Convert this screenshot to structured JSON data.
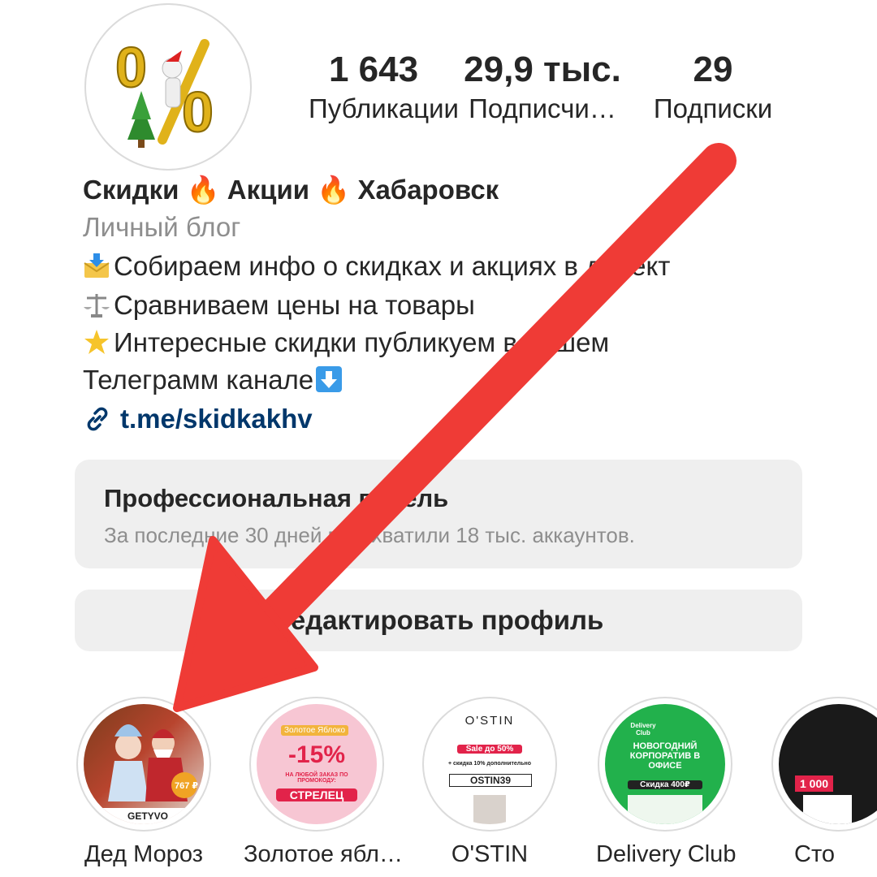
{
  "profile": {
    "avatar_text": "0%"
  },
  "stats": [
    {
      "value": "1 643",
      "label": "Публикации"
    },
    {
      "value": "29,9 тыс.",
      "label": "Подписчи…"
    },
    {
      "value": "29",
      "label": "Подписки"
    }
  ],
  "bio": {
    "title": "Скидки 🔥 Акции 🔥 Хабаровск",
    "category": "Личный блог",
    "line1": "Собираем инфо о скидках и акциях в директ",
    "line2": "Сравниваем цены на товары",
    "line3": "Интересные скидки публикуем в нашем",
    "line4": "Телеграмм канале",
    "link": "t.me/skidkakhv"
  },
  "professional_panel": {
    "title": "Профессиональная панель",
    "subtitle": "За последние 30 дней вы охватили 18 тыс. аккаунтов."
  },
  "edit_button": {
    "label": "Редактировать профиль"
  },
  "highlights": [
    {
      "label": "Дед Мороз",
      "cover_text": "767 ₽",
      "cover_sub": "GETYVO"
    },
    {
      "label": "Золотое ябл…",
      "cover_brand": "Золотое Яблоко",
      "cover_text": "-15%",
      "cover_sub": "НА ЛЮБОЙ ЗАКАЗ ПО ПРОМОКОДУ:",
      "cover_code": "СТРЕЛЕЦ"
    },
    {
      "label": "O'STIN",
      "cover_brand": "O'STIN",
      "cover_text": "Sale до 50%",
      "cover_sub": "+ скидка 10% дополнительно",
      "cover_code": "OSTIN39"
    },
    {
      "label": "Delivery Club",
      "cover_brand": "Delivery Club",
      "cover_text": "НОВОГОДНИЙ КОРПОРАТИВ В ОФИСЕ",
      "cover_code": "Скидка 400₽"
    },
    {
      "label": "Сто",
      "cover_text": "1 000"
    }
  ],
  "colors": {
    "arrow": "#ef3b36",
    "link": "#00376b",
    "panel": "#efefef"
  }
}
